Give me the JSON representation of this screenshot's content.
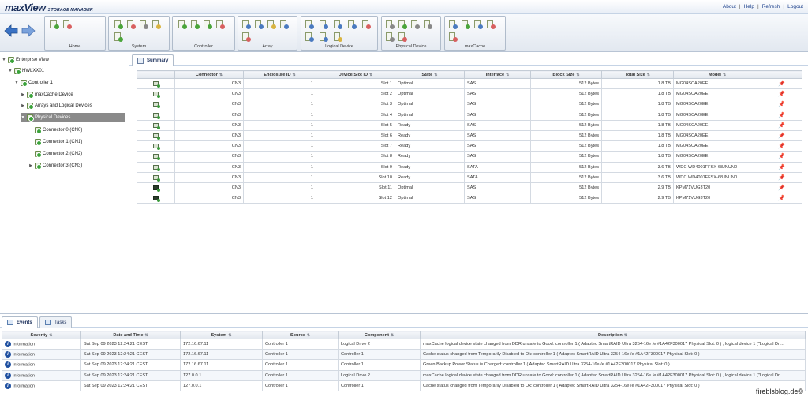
{
  "app": {
    "logo": "maxView",
    "logo_sub": "STORAGE MANAGER"
  },
  "toplinks": {
    "about": "About",
    "help": "Help",
    "refresh": "Refresh",
    "logout": "Logout",
    "separator": "|"
  },
  "toolbar": {
    "groups": [
      {
        "label": "Home"
      },
      {
        "label": "System"
      },
      {
        "label": "Controller"
      },
      {
        "label": "Array"
      },
      {
        "label": "Logical Device"
      },
      {
        "label": "Physical Device"
      },
      {
        "label": "maxCache"
      }
    ]
  },
  "tree": {
    "nodes": [
      {
        "label": "Enterprise View"
      },
      {
        "label": "HWLXX01"
      },
      {
        "label": "Controller 1"
      },
      {
        "label": "maxCache Device"
      },
      {
        "label": "Arrays and Logical Devices"
      },
      {
        "label": "Physical Devices"
      },
      {
        "label": "Connector 0 (CN0)"
      },
      {
        "label": "Connector 1 (CN1)"
      },
      {
        "label": "Connector 2 (CN2)"
      },
      {
        "label": "Connector 3 (CN3)"
      }
    ]
  },
  "summary": {
    "tab_label": "Summary",
    "columns": [
      "Connector",
      "Enclosure ID",
      "Device/Slot ID",
      "State",
      "Interface",
      "Block Size",
      "Total Size",
      "Model"
    ],
    "rows": [
      {
        "connector": "CN3",
        "enclosure": "1",
        "slot": "Slot 1",
        "state": "Optimal",
        "iface": "SAS",
        "block": "512 Bytes",
        "size": "1.8 TB",
        "model": "MG04SCA20EE",
        "ssd": false
      },
      {
        "connector": "CN3",
        "enclosure": "1",
        "slot": "Slot 2",
        "state": "Optimal",
        "iface": "SAS",
        "block": "512 Bytes",
        "size": "1.8 TB",
        "model": "MG04SCA20EE",
        "ssd": false
      },
      {
        "connector": "CN3",
        "enclosure": "1",
        "slot": "Slot 3",
        "state": "Optimal",
        "iface": "SAS",
        "block": "512 Bytes",
        "size": "1.8 TB",
        "model": "MG04SCA20EE",
        "ssd": false
      },
      {
        "connector": "CN3",
        "enclosure": "1",
        "slot": "Slot 4",
        "state": "Optimal",
        "iface": "SAS",
        "block": "512 Bytes",
        "size": "1.8 TB",
        "model": "MG04SCA20EE",
        "ssd": false
      },
      {
        "connector": "CN3",
        "enclosure": "1",
        "slot": "Slot 5",
        "state": "Ready",
        "iface": "SAS",
        "block": "512 Bytes",
        "size": "1.8 TB",
        "model": "MG04SCA20EE",
        "ssd": false
      },
      {
        "connector": "CN3",
        "enclosure": "1",
        "slot": "Slot 6",
        "state": "Ready",
        "iface": "SAS",
        "block": "512 Bytes",
        "size": "1.8 TB",
        "model": "MG04SCA20EE",
        "ssd": false
      },
      {
        "connector": "CN3",
        "enclosure": "1",
        "slot": "Slot 7",
        "state": "Ready",
        "iface": "SAS",
        "block": "512 Bytes",
        "size": "1.8 TB",
        "model": "MG04SCA20EE",
        "ssd": false
      },
      {
        "connector": "CN3",
        "enclosure": "1",
        "slot": "Slot 8",
        "state": "Ready",
        "iface": "SAS",
        "block": "512 Bytes",
        "size": "1.8 TB",
        "model": "MG04SCA20EE",
        "ssd": false
      },
      {
        "connector": "CN3",
        "enclosure": "1",
        "slot": "Slot 9",
        "state": "Ready",
        "iface": "SATA",
        "block": "512 Bytes",
        "size": "3.6 TB",
        "model": "WDC WD4001FFSX-68JNUN0",
        "ssd": false
      },
      {
        "connector": "CN3",
        "enclosure": "1",
        "slot": "Slot 10",
        "state": "Ready",
        "iface": "SATA",
        "block": "512 Bytes",
        "size": "3.6 TB",
        "model": "WDC WD4001FFSX-68JNUN0",
        "ssd": false
      },
      {
        "connector": "CN3",
        "enclosure": "1",
        "slot": "Slot 11",
        "state": "Optimal",
        "iface": "SAS",
        "block": "512 Bytes",
        "size": "2.9 TB",
        "model": "KPM71VUG3T20",
        "ssd": true
      },
      {
        "connector": "CN3",
        "enclosure": "1",
        "slot": "Slot 12",
        "state": "Optimal",
        "iface": "SAS",
        "block": "512 Bytes",
        "size": "2.9 TB",
        "model": "KPM71VUG3T20",
        "ssd": true
      }
    ]
  },
  "events": {
    "tabs": {
      "events": "Events",
      "tasks": "Tasks"
    },
    "columns": [
      "Severity",
      "Date and Time",
      "System",
      "Source",
      "Component",
      "Description"
    ],
    "rows": [
      {
        "severity": "Information",
        "datetime": "Sat Sep 09 2023 12:24:21 CEST",
        "system": "172.16.67.11",
        "source": "Controller 1",
        "component": "Logical Drive 2",
        "description": "maxCache logical device state changed from DDR unsafe to Good: controller 1 ( Adaptec SmartRAID Ultra 3254-16e /e #1A42F300017 Physical Slot: 0 ) , logical device 1 (\"Logical Dri..."
      },
      {
        "severity": "Information",
        "datetime": "Sat Sep 09 2023 12:24:21 CEST",
        "system": "172.16.67.11",
        "source": "Controller 1",
        "component": "Controller 1",
        "description": "Cache status changed from Temporarily Disabled to Ok: controller 1 ( Adaptec SmartRAID Ultra 3254-16e /e #1A42F300017 Physical Slot: 0 )"
      },
      {
        "severity": "Information",
        "datetime": "Sat Sep 09 2023 12:24:21 CEST",
        "system": "172.16.67.11",
        "source": "Controller 1",
        "component": "Controller 1",
        "description": "Green Backup Power Status is Charged: controller 1 ( Adaptec SmartRAID Ultra 3254-16e /e #1A42F300017 Physical Slot: 0 )"
      },
      {
        "severity": "Information",
        "datetime": "Sat Sep 09 2023 12:24:21 CEST",
        "system": "127.0.0.1",
        "source": "Controller 1",
        "component": "Logical Drive 2",
        "description": "maxCache logical device state changed from DDR unsafe to Good: controller 1 ( Adaptec SmartRAID Ultra 3254-16e /e #1A42F300017 Physical Slot: 0 ) , logical device 1 (\"Logical Dri..."
      },
      {
        "severity": "Information",
        "datetime": "Sat Sep 09 2023 12:24:21 CEST",
        "system": "127.0.0.1",
        "source": "Controller 1",
        "component": "Controller 1",
        "description": "Cache status changed from Temporarily Disabled to Ok: controller 1 ( Adaptec SmartRAID Ultra 3254-16e /e #1A42F300017 Physical Slot: 0 )"
      }
    ]
  },
  "watermark": "fireblsblog.de©"
}
